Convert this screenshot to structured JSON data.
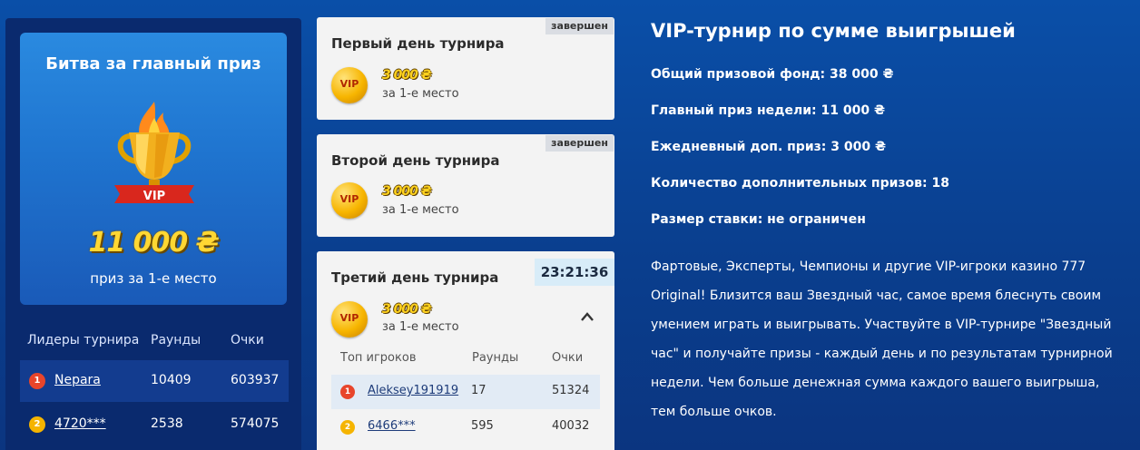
{
  "prize_card": {
    "title": "Битва за главный приз",
    "trophy_label": "VIP",
    "amount": "11 000 ₴",
    "subtitle": "приз за 1-е место"
  },
  "leaders": {
    "headers": [
      "Лидеры турнира",
      "Раунды",
      "Очки"
    ],
    "rows": [
      {
        "rank": "1",
        "name": "Nepara",
        "rounds": "10409",
        "points": "603937"
      },
      {
        "rank": "2",
        "name": "4720***",
        "rounds": "2538",
        "points": "574075"
      }
    ]
  },
  "days": [
    {
      "title": "Первый день турнира",
      "status": "завершен",
      "coin": "VIP",
      "amount": "3 000 ₴",
      "place": "за 1-е место"
    },
    {
      "title": "Второй день турнира",
      "status": "завершен",
      "coin": "VIP",
      "amount": "3 000 ₴",
      "place": "за 1-е место"
    },
    {
      "title": "Третий день турнира",
      "timer": "23:21:36",
      "coin": "VIP",
      "amount": "3 000 ₴",
      "place": "за 1-е место"
    }
  ],
  "top_players": {
    "headers": [
      "Топ игроков",
      "Раунды",
      "Очки"
    ],
    "rows": [
      {
        "rank": "1",
        "name": "Aleksey191919",
        "rounds": "17",
        "points": "51324"
      },
      {
        "rank": "2",
        "name": "6466***",
        "rounds": "595",
        "points": "40032"
      }
    ]
  },
  "info": {
    "title": "VIP-турнир по сумме выигрышей",
    "lines": [
      "Общий призовой фонд: 38 000 ₴",
      "Главный приз недели: 11 000 ₴",
      "Ежедневный доп. приз: 3 000 ₴",
      "Количество дополнительных призов: 18",
      "Размер ставки: не ограничен"
    ],
    "description": "Фартовые, Эксперты, Чемпионы и другие VIP-игроки казино 777 Original! Близится ваш Звездный час, самое время блеснуть своим умением играть и выигрывать. Участвуйте в VIP-турнире \"Звездный час\" и получайте призы - каждый день и по результатам турнирной недели. Чем больше денежная сумма каждого вашего выигрыша, тем больше очков."
  },
  "colors": {
    "background": "#0a4fa8",
    "panel": "#0a2a6e",
    "gold": "#ffd733",
    "rank1": "#e8452b",
    "rank2": "#f5b400"
  }
}
